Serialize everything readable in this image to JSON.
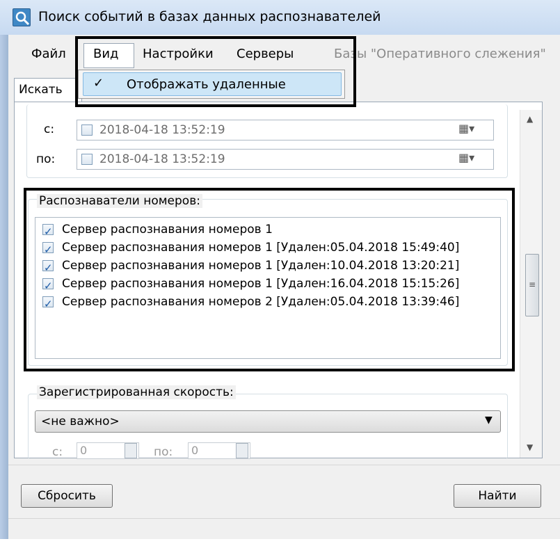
{
  "window": {
    "title": "Поиск событий в базах данных распознавателей",
    "icon": "search-icon"
  },
  "menubar": {
    "items": [
      "Файл",
      "Вид",
      "Настройки",
      "Серверы",
      "Базы \"Оперативного слежения\""
    ]
  },
  "view_menu": {
    "item_label": "Отображать удаленные",
    "checked": true
  },
  "tabs": {
    "search_label": "Искать"
  },
  "date_range": {
    "from_label": "с:",
    "from_value": "2018-04-18 13:52:19",
    "to_label": "по:",
    "to_value": "2018-04-18 13:52:19"
  },
  "recognizers": {
    "title": "Распознаватели номеров:",
    "items": [
      "Сервер распознавания номеров 1",
      "Сервер распознавания номеров 1 [Удален:05.04.2018 15:49:40]",
      "Сервер распознавания номеров 1 [Удален:10.04.2018 13:20:21]",
      "Сервер распознавания номеров 1 [Удален:16.04.2018 15:15:26]",
      "Сервер распознавания номеров 2 [Удален:05.04.2018 13:39:46]"
    ]
  },
  "speed": {
    "title": "Зарегистрированная скорость:",
    "select_value": "<не важно>",
    "from_label": "с:",
    "from_value": "0",
    "to_label": "по:",
    "to_value": "0"
  },
  "buttons": {
    "reset": "Сбросить",
    "find": "Найти"
  },
  "colors": {
    "menu_highlight": "#cde6f7",
    "title_bar": "#c7daf1",
    "check": "#1c5aa6"
  }
}
